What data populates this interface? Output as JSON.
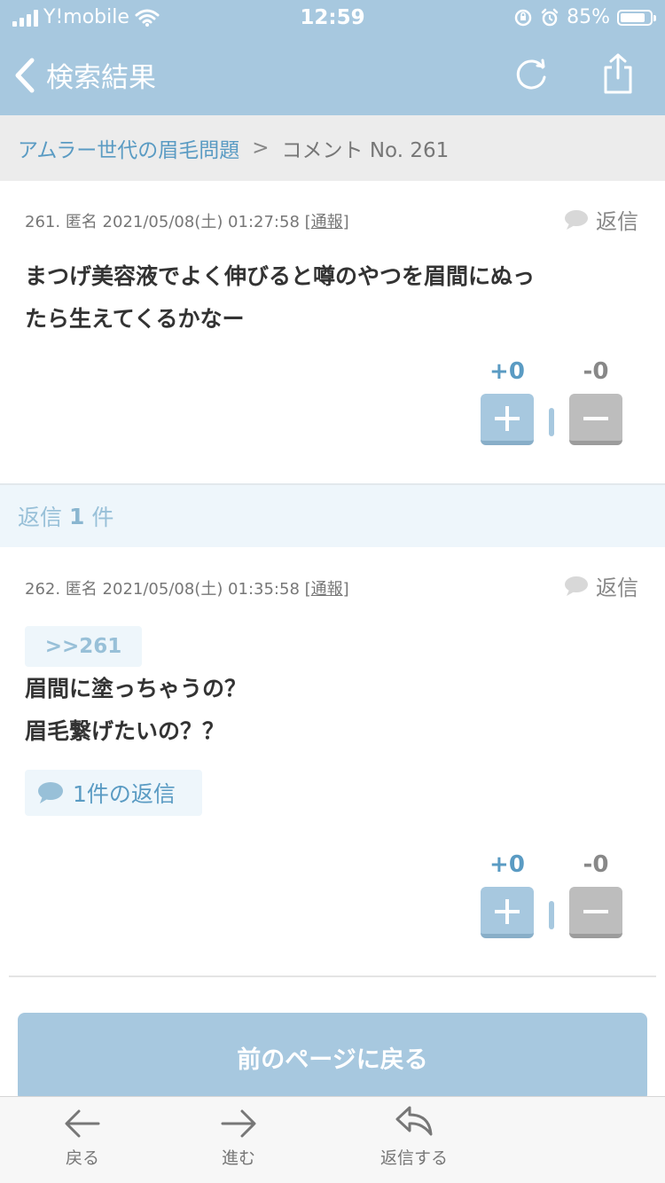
{
  "status_bar": {
    "carrier": "Y!mobile",
    "time": "12:59",
    "battery": "85%",
    "battery_level": 0.85
  },
  "nav": {
    "title": "検索結果"
  },
  "breadcrumb": {
    "topic": "アムラー世代の眉毛問題",
    "separator": ">",
    "current": "コメント No. 261"
  },
  "comments": [
    {
      "number": "261.",
      "author": "匿名",
      "datetime": "2021/05/08(土) 01:27:58",
      "report_open": "[",
      "report": "通報",
      "report_close": "]",
      "reply_label": "返信",
      "line1": "まつげ美容液でよく伸びると噂のやつを眉間にぬっ",
      "line2": "たら生えてくるかなー",
      "plus": "+0",
      "minus": "-0"
    },
    {
      "number": "262.",
      "author": "匿名",
      "datetime": "2021/05/08(土) 01:35:58",
      "report_open": "[",
      "report": "通報",
      "report_close": "]",
      "reply_label": "返信",
      "anchor": ">>261",
      "line1": "眉間に塗っちゃうの？",
      "line2": "眉毛繋げたいの？？",
      "replies": "1件の返信",
      "plus": "+0",
      "minus": "-0"
    }
  ],
  "replies_section": {
    "label": "返信",
    "count": "1",
    "unit": "件"
  },
  "prev_page_button": "前のページに戻る",
  "toolbar": {
    "back": "戻る",
    "forward": "進む",
    "reply": "返信する"
  },
  "colors": {
    "brand": "#a7c8df",
    "link": "#5a9bc3"
  }
}
